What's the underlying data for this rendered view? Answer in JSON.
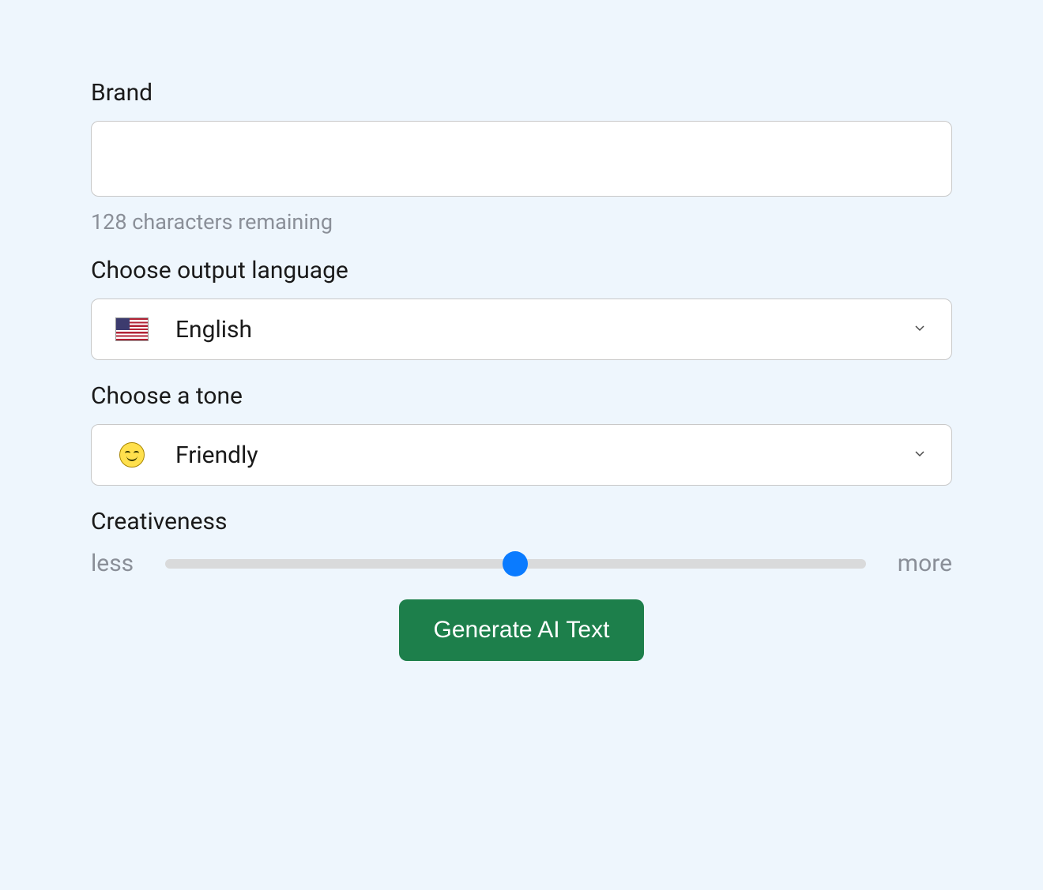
{
  "brand": {
    "label": "Brand",
    "value": "",
    "helper": "128 characters remaining"
  },
  "language": {
    "label": "Choose output language",
    "selected": "English",
    "icon_name": "flag-us-icon"
  },
  "tone": {
    "label": "Choose a tone",
    "selected": "Friendly",
    "icon_name": "smile-icon"
  },
  "creativeness": {
    "label": "Creativeness",
    "min_label": "less",
    "max_label": "more",
    "value_percent": 50
  },
  "submit": {
    "label": "Generate AI Text"
  }
}
